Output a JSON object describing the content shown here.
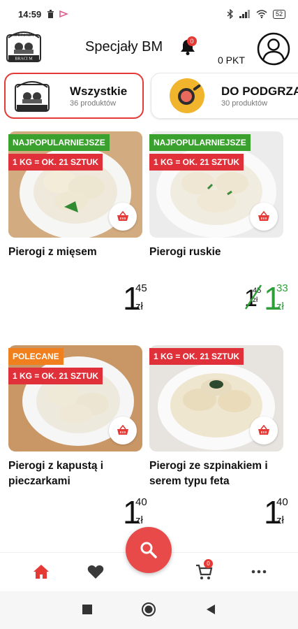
{
  "status": {
    "time": "14:59",
    "battery": "52"
  },
  "header": {
    "title": "Specjały BM",
    "bell_badge": "0",
    "points": "0 PKT"
  },
  "logo": {
    "text_top": "SPECJAŁY",
    "text_bottom": "BRACI M"
  },
  "categories": [
    {
      "name": "Wszystkie",
      "count": "36 produktów"
    },
    {
      "name": "DO PODGRZANIA",
      "count": "30 produktów"
    }
  ],
  "products": [
    {
      "name": "Pierogi z mięsem",
      "tags": [
        "NAJPOPULARNIEJSZE",
        "1 KG = OK. 21 SZTUK"
      ],
      "price_int": "1",
      "price_dec": "45",
      "currency": "zł"
    },
    {
      "name": "Pierogi ruskie",
      "tags": [
        "NAJPOPULARNIEJSZE",
        "1 KG = OK. 21 SZTUK"
      ],
      "old_price_int": "1",
      "old_price_dec": "45",
      "price_int": "1",
      "price_dec": "33",
      "currency": "zł"
    },
    {
      "name": "Pierogi z kapustą i pieczarkami",
      "tags": [
        "POLECANE",
        "1 KG = OK. 21 SZTUK"
      ],
      "price_int": "1",
      "price_dec": "40",
      "currency": "zł"
    },
    {
      "name": "Pierogi ze szpinakiem i serem typu feta",
      "tags": [
        "1 KG = OK. 21 SZTUK"
      ],
      "price_int": "1",
      "price_dec": "40",
      "currency": "zł"
    }
  ],
  "bottom_nav": {
    "cart_badge": "0",
    "items": [
      "home-icon",
      "heart-icon",
      "search-icon",
      "cart-icon",
      "more-icon"
    ]
  },
  "colors": {
    "accent": "#e53935",
    "green_tag": "#3aa12f",
    "red_tag": "#e0313a",
    "orange_tag": "#f0801e",
    "promo_price": "#2e9e3a"
  }
}
